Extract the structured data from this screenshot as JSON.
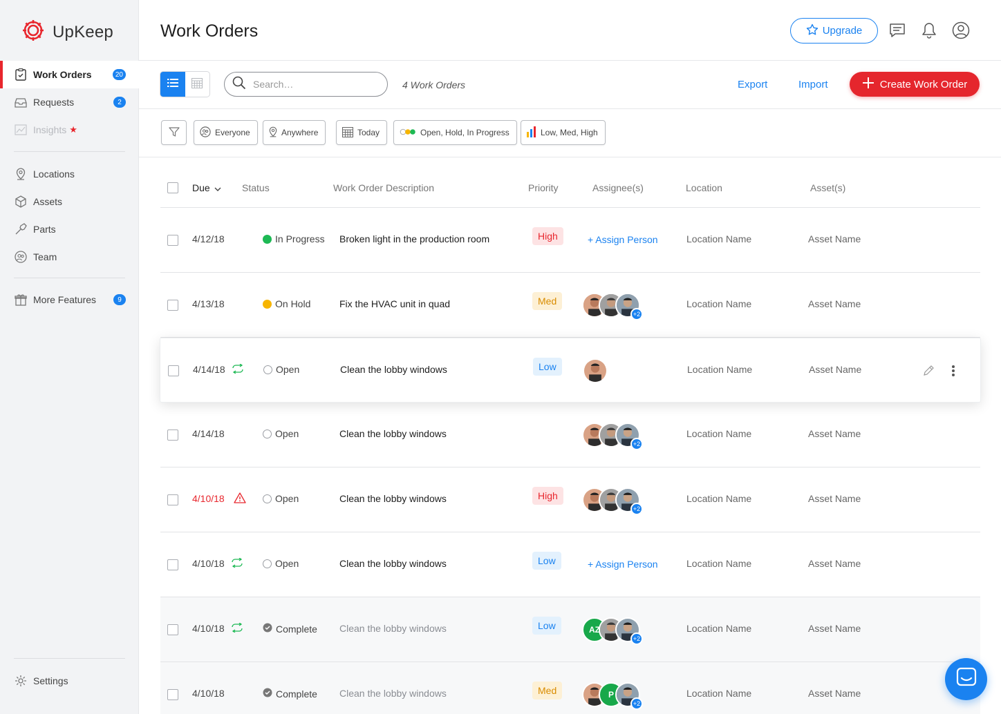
{
  "app": {
    "name": "UpKeep",
    "brand_color": "#e8262d",
    "accent_color": "#1a82f0"
  },
  "sidebar": {
    "items": [
      {
        "label": "Work Orders",
        "icon": "clipboard-icon",
        "badge": "20",
        "active": true
      },
      {
        "label": "Requests",
        "icon": "inbox-icon",
        "badge": "2"
      },
      {
        "label": "Insights",
        "icon": "chart-icon",
        "star": "★",
        "muted": true
      },
      {
        "label": "Locations",
        "icon": "location-pin-icon"
      },
      {
        "label": "Assets",
        "icon": "cube-icon"
      },
      {
        "label": "Parts",
        "icon": "wrench-icon"
      },
      {
        "label": "Team",
        "icon": "team-icon"
      },
      {
        "label": "More Features",
        "icon": "gift-icon",
        "badge": "9"
      }
    ],
    "settings_label": "Settings"
  },
  "header": {
    "title": "Work Orders",
    "upgrade_label": "Upgrade"
  },
  "toolbar": {
    "search_placeholder": "Search…",
    "count_label": "4 Work Orders",
    "export_label": "Export",
    "import_label": "Import",
    "create_label": "Create Work Order"
  },
  "filters": [
    {
      "label": "Everyone",
      "icon": "team-icon"
    },
    {
      "label": "Anywhere",
      "icon": "location-pin-icon"
    },
    {
      "label": "Today",
      "icon": "calendar-icon"
    },
    {
      "label": "Open, Hold, In Progress",
      "icon": "status-dots-icon"
    },
    {
      "label": "Low, Med, High",
      "icon": "priority-bars-icon"
    }
  ],
  "table": {
    "columns": [
      "Due",
      "Status",
      "Work Order Description",
      "Priority",
      "Assignee(s)",
      "Location",
      "Asset(s)"
    ],
    "rows": [
      {
        "due": "4/12/18",
        "status": "In Progress",
        "description": "Broken light in the production room",
        "priority": "High",
        "assignee": "+ Assign Person",
        "location": "Location Name",
        "asset": "Asset Name"
      },
      {
        "due": "4/13/18",
        "status": "On Hold",
        "description": "Fix the HVAC unit in quad",
        "priority": "Med",
        "assignee_more": "+2",
        "location": "Location Name",
        "asset": "Asset Name"
      },
      {
        "due": "4/14/18",
        "status": "Open",
        "description": "Clean the lobby windows",
        "priority": "Low",
        "location": "Location Name",
        "asset": "Asset Name",
        "repeat": true
      },
      {
        "due": "4/14/18",
        "status": "Open",
        "description": "Clean the lobby windows",
        "assignee_more": "+2",
        "location": "Location Name",
        "asset": "Asset Name"
      },
      {
        "due": "4/10/18",
        "status": "Open",
        "description": "Clean the lobby windows",
        "priority": "High",
        "assignee_more": "+2",
        "location": "Location Name",
        "asset": "Asset Name",
        "overdue": true
      },
      {
        "due": "4/10/18",
        "status": "Open",
        "description": "Clean the lobby windows",
        "priority": "Low",
        "assignee": "+ Assign Person",
        "location": "Location Name",
        "asset": "Asset Name",
        "repeat": true
      },
      {
        "due": "4/10/18",
        "status": "Complete",
        "description": "Clean the lobby windows",
        "priority": "Low",
        "avatar_initials": "AZ",
        "assignee_more": "+2",
        "location": "Location Name",
        "asset": "Asset Name",
        "repeat": true
      },
      {
        "due": "4/10/18",
        "status": "Complete",
        "description": "Clean the lobby windows",
        "priority": "Med",
        "avatar_initials": "P",
        "assignee_more": "+2",
        "location": "Location Name",
        "asset": "Asset Name"
      }
    ]
  },
  "colors": {
    "in_progress": "#1db954",
    "on_hold": "#f7b500",
    "high_bg": "#fde3e4",
    "high_fg": "#e8262d",
    "med_bg": "#fdf0d5",
    "med_fg": "#d98c00",
    "low_bg": "#e3f1fd",
    "low_fg": "#1a82f0"
  }
}
